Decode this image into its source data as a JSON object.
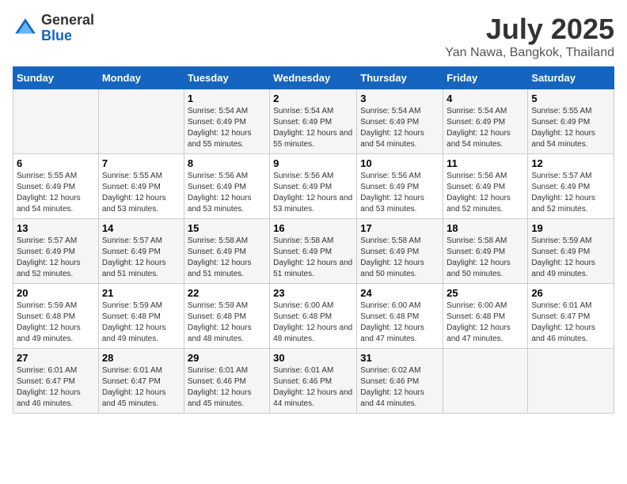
{
  "logo": {
    "general": "General",
    "blue": "Blue"
  },
  "header": {
    "title": "July 2025",
    "subtitle": "Yan Nawa, Bangkok, Thailand"
  },
  "days_of_week": [
    "Sunday",
    "Monday",
    "Tuesday",
    "Wednesday",
    "Thursday",
    "Friday",
    "Saturday"
  ],
  "weeks": [
    [
      {
        "day": "",
        "sunrise": "",
        "sunset": "",
        "daylight": ""
      },
      {
        "day": "",
        "sunrise": "",
        "sunset": "",
        "daylight": ""
      },
      {
        "day": "1",
        "sunrise": "Sunrise: 5:54 AM",
        "sunset": "Sunset: 6:49 PM",
        "daylight": "Daylight: 12 hours and 55 minutes."
      },
      {
        "day": "2",
        "sunrise": "Sunrise: 5:54 AM",
        "sunset": "Sunset: 6:49 PM",
        "daylight": "Daylight: 12 hours and 55 minutes."
      },
      {
        "day": "3",
        "sunrise": "Sunrise: 5:54 AM",
        "sunset": "Sunset: 6:49 PM",
        "daylight": "Daylight: 12 hours and 54 minutes."
      },
      {
        "day": "4",
        "sunrise": "Sunrise: 5:54 AM",
        "sunset": "Sunset: 6:49 PM",
        "daylight": "Daylight: 12 hours and 54 minutes."
      },
      {
        "day": "5",
        "sunrise": "Sunrise: 5:55 AM",
        "sunset": "Sunset: 6:49 PM",
        "daylight": "Daylight: 12 hours and 54 minutes."
      }
    ],
    [
      {
        "day": "6",
        "sunrise": "Sunrise: 5:55 AM",
        "sunset": "Sunset: 6:49 PM",
        "daylight": "Daylight: 12 hours and 54 minutes."
      },
      {
        "day": "7",
        "sunrise": "Sunrise: 5:55 AM",
        "sunset": "Sunset: 6:49 PM",
        "daylight": "Daylight: 12 hours and 53 minutes."
      },
      {
        "day": "8",
        "sunrise": "Sunrise: 5:56 AM",
        "sunset": "Sunset: 6:49 PM",
        "daylight": "Daylight: 12 hours and 53 minutes."
      },
      {
        "day": "9",
        "sunrise": "Sunrise: 5:56 AM",
        "sunset": "Sunset: 6:49 PM",
        "daylight": "Daylight: 12 hours and 53 minutes."
      },
      {
        "day": "10",
        "sunrise": "Sunrise: 5:56 AM",
        "sunset": "Sunset: 6:49 PM",
        "daylight": "Daylight: 12 hours and 53 minutes."
      },
      {
        "day": "11",
        "sunrise": "Sunrise: 5:56 AM",
        "sunset": "Sunset: 6:49 PM",
        "daylight": "Daylight: 12 hours and 52 minutes."
      },
      {
        "day": "12",
        "sunrise": "Sunrise: 5:57 AM",
        "sunset": "Sunset: 6:49 PM",
        "daylight": "Daylight: 12 hours and 52 minutes."
      }
    ],
    [
      {
        "day": "13",
        "sunrise": "Sunrise: 5:57 AM",
        "sunset": "Sunset: 6:49 PM",
        "daylight": "Daylight: 12 hours and 52 minutes."
      },
      {
        "day": "14",
        "sunrise": "Sunrise: 5:57 AM",
        "sunset": "Sunset: 6:49 PM",
        "daylight": "Daylight: 12 hours and 51 minutes."
      },
      {
        "day": "15",
        "sunrise": "Sunrise: 5:58 AM",
        "sunset": "Sunset: 6:49 PM",
        "daylight": "Daylight: 12 hours and 51 minutes."
      },
      {
        "day": "16",
        "sunrise": "Sunrise: 5:58 AM",
        "sunset": "Sunset: 6:49 PM",
        "daylight": "Daylight: 12 hours and 51 minutes."
      },
      {
        "day": "17",
        "sunrise": "Sunrise: 5:58 AM",
        "sunset": "Sunset: 6:49 PM",
        "daylight": "Daylight: 12 hours and 50 minutes."
      },
      {
        "day": "18",
        "sunrise": "Sunrise: 5:58 AM",
        "sunset": "Sunset: 6:49 PM",
        "daylight": "Daylight: 12 hours and 50 minutes."
      },
      {
        "day": "19",
        "sunrise": "Sunrise: 5:59 AM",
        "sunset": "Sunset: 6:49 PM",
        "daylight": "Daylight: 12 hours and 49 minutes."
      }
    ],
    [
      {
        "day": "20",
        "sunrise": "Sunrise: 5:59 AM",
        "sunset": "Sunset: 6:48 PM",
        "daylight": "Daylight: 12 hours and 49 minutes."
      },
      {
        "day": "21",
        "sunrise": "Sunrise: 5:59 AM",
        "sunset": "Sunset: 6:48 PM",
        "daylight": "Daylight: 12 hours and 49 minutes."
      },
      {
        "day": "22",
        "sunrise": "Sunrise: 5:59 AM",
        "sunset": "Sunset: 6:48 PM",
        "daylight": "Daylight: 12 hours and 48 minutes."
      },
      {
        "day": "23",
        "sunrise": "Sunrise: 6:00 AM",
        "sunset": "Sunset: 6:48 PM",
        "daylight": "Daylight: 12 hours and 48 minutes."
      },
      {
        "day": "24",
        "sunrise": "Sunrise: 6:00 AM",
        "sunset": "Sunset: 6:48 PM",
        "daylight": "Daylight: 12 hours and 47 minutes."
      },
      {
        "day": "25",
        "sunrise": "Sunrise: 6:00 AM",
        "sunset": "Sunset: 6:48 PM",
        "daylight": "Daylight: 12 hours and 47 minutes."
      },
      {
        "day": "26",
        "sunrise": "Sunrise: 6:01 AM",
        "sunset": "Sunset: 6:47 PM",
        "daylight": "Daylight: 12 hours and 46 minutes."
      }
    ],
    [
      {
        "day": "27",
        "sunrise": "Sunrise: 6:01 AM",
        "sunset": "Sunset: 6:47 PM",
        "daylight": "Daylight: 12 hours and 46 minutes."
      },
      {
        "day": "28",
        "sunrise": "Sunrise: 6:01 AM",
        "sunset": "Sunset: 6:47 PM",
        "daylight": "Daylight: 12 hours and 45 minutes."
      },
      {
        "day": "29",
        "sunrise": "Sunrise: 6:01 AM",
        "sunset": "Sunset: 6:46 PM",
        "daylight": "Daylight: 12 hours and 45 minutes."
      },
      {
        "day": "30",
        "sunrise": "Sunrise: 6:01 AM",
        "sunset": "Sunset: 6:46 PM",
        "daylight": "Daylight: 12 hours and 44 minutes."
      },
      {
        "day": "31",
        "sunrise": "Sunrise: 6:02 AM",
        "sunset": "Sunset: 6:46 PM",
        "daylight": "Daylight: 12 hours and 44 minutes."
      },
      {
        "day": "",
        "sunrise": "",
        "sunset": "",
        "daylight": ""
      },
      {
        "day": "",
        "sunrise": "",
        "sunset": "",
        "daylight": ""
      }
    ]
  ]
}
